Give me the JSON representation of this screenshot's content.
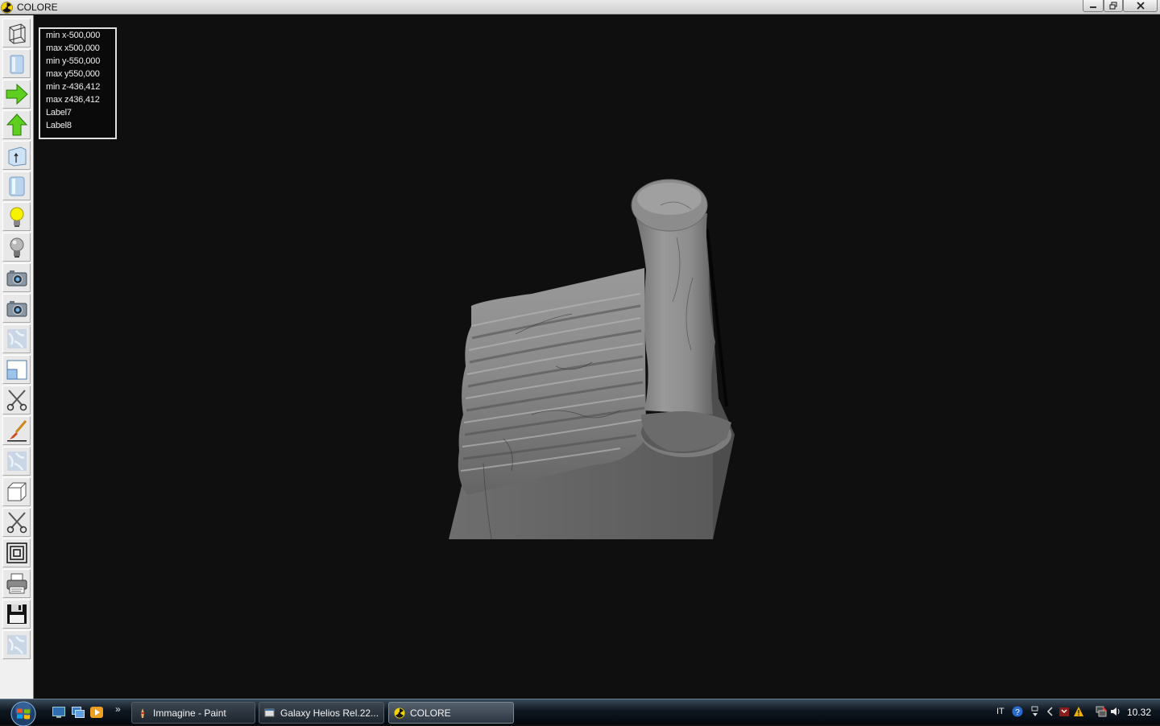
{
  "window": {
    "title": "COLORE",
    "icon": "radiation-icon"
  },
  "info_panel": {
    "lines": [
      "min x-500,000",
      "max x500,000",
      "min y-550,000",
      "max y550,000",
      "min z-436,412",
      "max z436,412",
      "Label7",
      "Label8"
    ]
  },
  "toolbar": {
    "buttons": [
      "wireframe-box-icon",
      "solid-box-icon",
      "arrow-right-icon",
      "arrow-up-icon",
      "extrude-box-icon",
      "cylinder-icon",
      "light-on-icon",
      "light-off-icon",
      "camera-icon",
      "camera-2-icon",
      "marble-texture-icon",
      "viewport-split-icon",
      "scissors-icon",
      "paintbrush-icon",
      "marble-texture-2-icon",
      "cube-icon",
      "scissors-2-icon",
      "concentric-squares-icon",
      "printer-icon",
      "floppy-disk-icon",
      "marble-texture-3-icon"
    ]
  },
  "taskbar": {
    "tasks": [
      {
        "label": "Immagine - Paint",
        "icon": "paint-icon",
        "active": false
      },
      {
        "label": "Galaxy Helios  Rel.22...",
        "icon": "app-window-icon",
        "active": false
      },
      {
        "label": "COLORE",
        "icon": "radiation-icon",
        "active": true
      }
    ],
    "language": "IT",
    "clock": "10.32",
    "quick_launch": [
      "show-desktop-icon",
      "switch-windows-icon",
      "media-player-icon"
    ]
  }
}
